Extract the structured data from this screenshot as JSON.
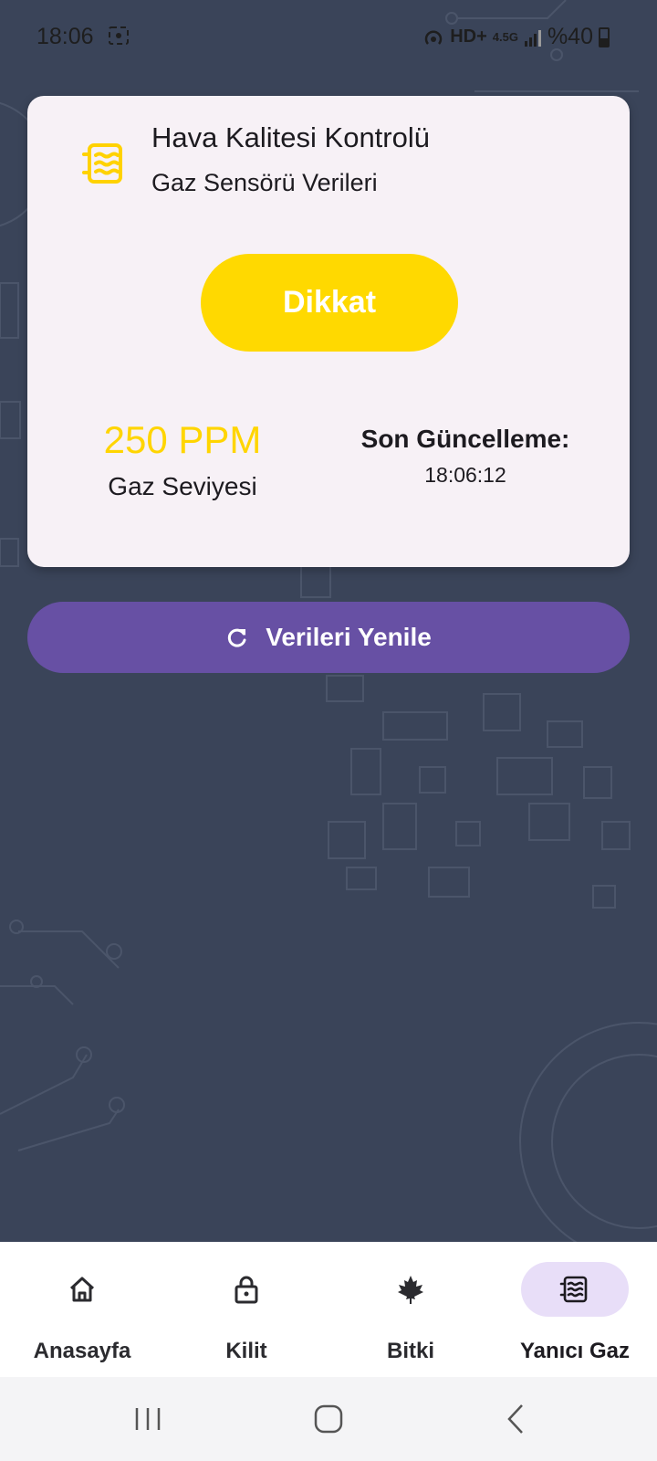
{
  "status_bar": {
    "time": "18:06",
    "network": "HD+",
    "network_small": "4.5G",
    "battery": "%40",
    "icons": [
      "screen-record-icon",
      "hotspot-icon",
      "signal-icon",
      "battery-icon"
    ]
  },
  "card": {
    "title": "Hava Kalitesi Kontrolü",
    "subtitle": "Gaz Sensörü Verileri",
    "status": "Dikkat",
    "gas_value": "250 PPM",
    "gas_label": "Gaz Seviyesi",
    "update_label": "Son Güncelleme:",
    "update_time": "18:06:12",
    "icon": "gas-sensor-icon"
  },
  "refresh_label": "Verileri Yenile",
  "bottom_nav": {
    "items": [
      {
        "label": "Anasayfa",
        "icon": "home-icon"
      },
      {
        "label": "Kilit",
        "icon": "lock-icon"
      },
      {
        "label": "Bitki",
        "icon": "leaf-icon"
      },
      {
        "label": "Yanıcı Gaz",
        "icon": "gas-sensor-icon",
        "active": true
      }
    ]
  },
  "colors": {
    "background": "#3a4459",
    "card": "#f7f1f6",
    "warning": "#ffd900",
    "primary": "#6750a4",
    "nav_active": "#e8def8"
  }
}
